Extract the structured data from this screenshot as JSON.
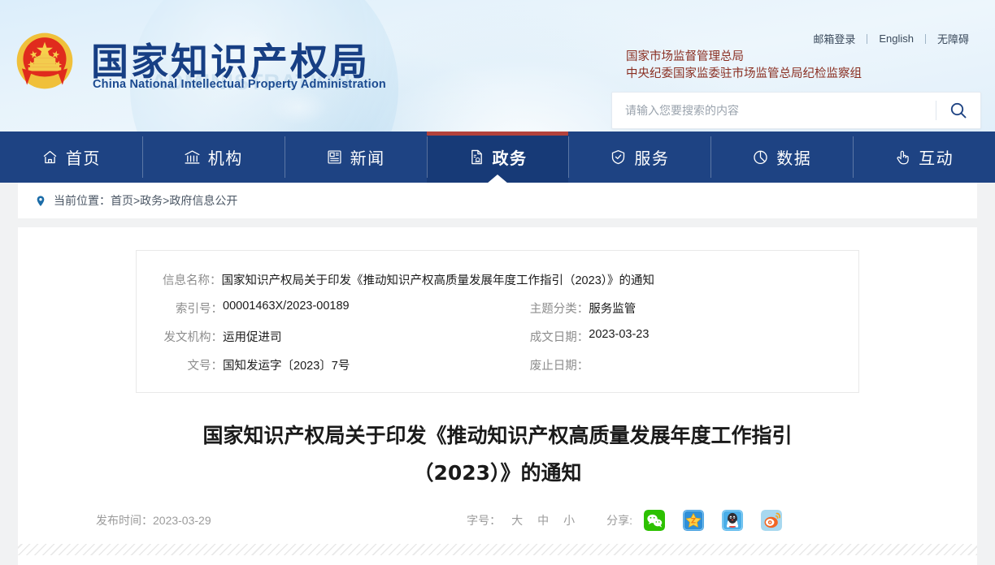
{
  "header": {
    "site_title_cn": "国家知识产权局",
    "site_title_en": "China National Intellectual Property Administration",
    "watermark": "ADMINISTRATION",
    "top_links": [
      {
        "label": "邮箱登录"
      },
      {
        "label": "English"
      },
      {
        "label": "无障碍"
      }
    ],
    "agency_line1": "国家市场监督管理总局",
    "agency_line2": "中央纪委国家监委驻市场监管总局纪检监察组",
    "search": {
      "placeholder": "请输入您要搜索的内容",
      "value": "",
      "button_icon": "search-icon"
    },
    "emblem_icon": "national-emblem-icon"
  },
  "nav": {
    "items": [
      {
        "label": "首页",
        "icon": "home-icon",
        "active": false
      },
      {
        "label": "机构",
        "icon": "bank-icon",
        "active": false
      },
      {
        "label": "新闻",
        "icon": "newspaper-icon",
        "active": false
      },
      {
        "label": "政务",
        "icon": "document-seal-icon",
        "active": true
      },
      {
        "label": "服务",
        "icon": "shield-check-icon",
        "active": false
      },
      {
        "label": "数据",
        "icon": "pie-chart-icon",
        "active": false
      },
      {
        "label": "互动",
        "icon": "hand-click-icon",
        "active": false
      }
    ],
    "active_color": "#b2423c",
    "background_color": "#1e4383"
  },
  "breadcrumb": {
    "icon": "location-pin-icon",
    "text": "当前位置：首页>政务>政府信息公开"
  },
  "info_table": {
    "rows": [
      {
        "label": "信息名称：",
        "value": "国家知识产权局关于印发《推动知识产权高质量发展年度工作指引（2023）》的通知"
      },
      {
        "label": "索引号：",
        "value": "00001463X/2023-00189",
        "label2": "主题分类：",
        "value2": "服务监管"
      },
      {
        "label": "发文机构：",
        "value": "运用促进司",
        "label2": "成文日期：",
        "value2": "2023-03-23"
      },
      {
        "label": "文号：",
        "value": "国知发运字〔2023〕7号",
        "label2": "废止日期：",
        "value2": ""
      }
    ]
  },
  "article": {
    "title_line1": "国家知识产权局关于印发《推动知识产权高质量发展年度工作指引",
    "title_line2": "（2023）》的通知",
    "publish_time": "发布时间：2023-03-29"
  },
  "toolbar": {
    "font_size_label": "字号：",
    "font_sizes": [
      {
        "label": "大"
      },
      {
        "label": "中"
      },
      {
        "label": "小"
      }
    ],
    "share_label": "分享:",
    "share_items": [
      {
        "name": "wechat",
        "color": "#2dc100"
      },
      {
        "name": "qzone",
        "color": "#2f8fd8"
      },
      {
        "name": "qq",
        "color": "#4aaee8"
      },
      {
        "name": "weibo",
        "color": "#a8d8ef"
      }
    ]
  }
}
